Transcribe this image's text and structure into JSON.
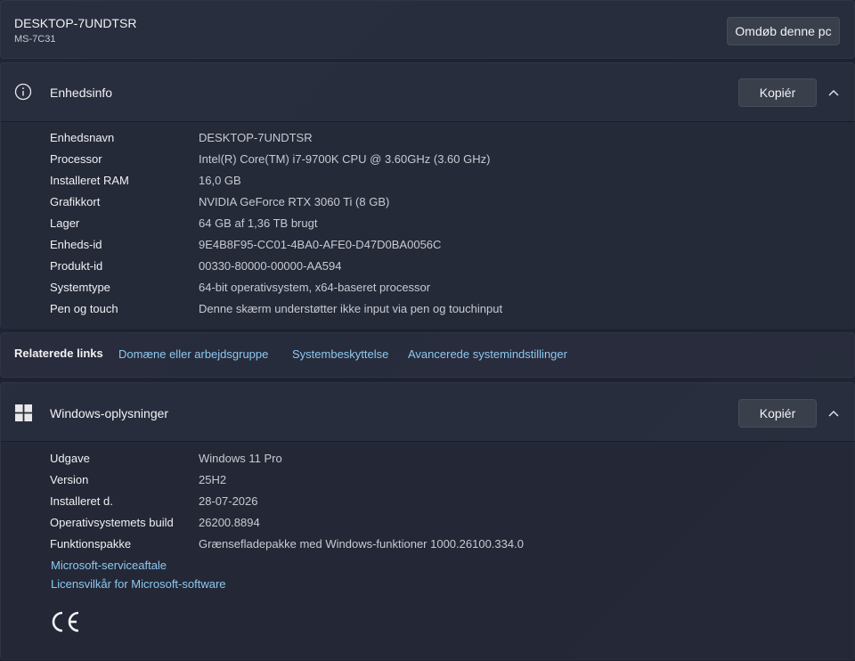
{
  "device": {
    "name": "DESKTOP-7UNDTSR",
    "model": "MS-7C31",
    "rename_button": "Omdøb denne pc"
  },
  "device_info": {
    "title": "Enhedsinfo",
    "copy_button": "Kopiér",
    "rows": [
      {
        "label": "Enhedsnavn",
        "value": "DESKTOP-7UNDTSR"
      },
      {
        "label": "Processor",
        "value": "Intel(R) Core(TM) i7-9700K CPU @ 3.60GHz (3.60 GHz)"
      },
      {
        "label": "Installeret RAM",
        "value": "16,0 GB"
      },
      {
        "label": "Grafikkort",
        "value": "NVIDIA GeForce RTX 3060 Ti (8 GB)"
      },
      {
        "label": "Lager",
        "value": "64 GB af 1,36 TB brugt"
      },
      {
        "label": "Enheds-id",
        "value": "9E4B8F95-CC01-4BA0-AFE0-D47D0BA0056C"
      },
      {
        "label": "Produkt-id",
        "value": "00330-80000-00000-AA594"
      },
      {
        "label": "Systemtype",
        "value": "64-bit operativsystem, x64-baseret processor"
      },
      {
        "label": "Pen og touch",
        "value": "Denne skærm understøtter ikke input via pen og touchinput"
      }
    ]
  },
  "related_links": {
    "label": "Relaterede links",
    "links": [
      "Domæne eller arbejdsgruppe",
      "Systembeskyttelse",
      "Avancerede systemindstillinger"
    ]
  },
  "windows_info": {
    "title": "Windows-oplysninger",
    "copy_button": "Kopiér",
    "rows": [
      {
        "label": "Udgave",
        "value": "Windows 11 Pro"
      },
      {
        "label": "Version",
        "value": "25H2"
      },
      {
        "label": "Installeret d.",
        "value": "28-07-2026"
      },
      {
        "label": "Operativsystemets build",
        "value": "26200.8894"
      },
      {
        "label": "Funktionspakke",
        "value": "Grænsefladepakke med Windows-funktioner 1000.26100.334.0"
      }
    ],
    "links": [
      "Microsoft-serviceaftale",
      "Licensvilkår for Microsoft-software"
    ],
    "ce_mark": "CE"
  },
  "icons": {
    "info": "info-icon",
    "windows": "windows-logo-icon",
    "chevron": "chevron-up-icon"
  },
  "colors": {
    "link": "#8dc8f0",
    "background": "#1d2232",
    "card": "#2c3140"
  }
}
